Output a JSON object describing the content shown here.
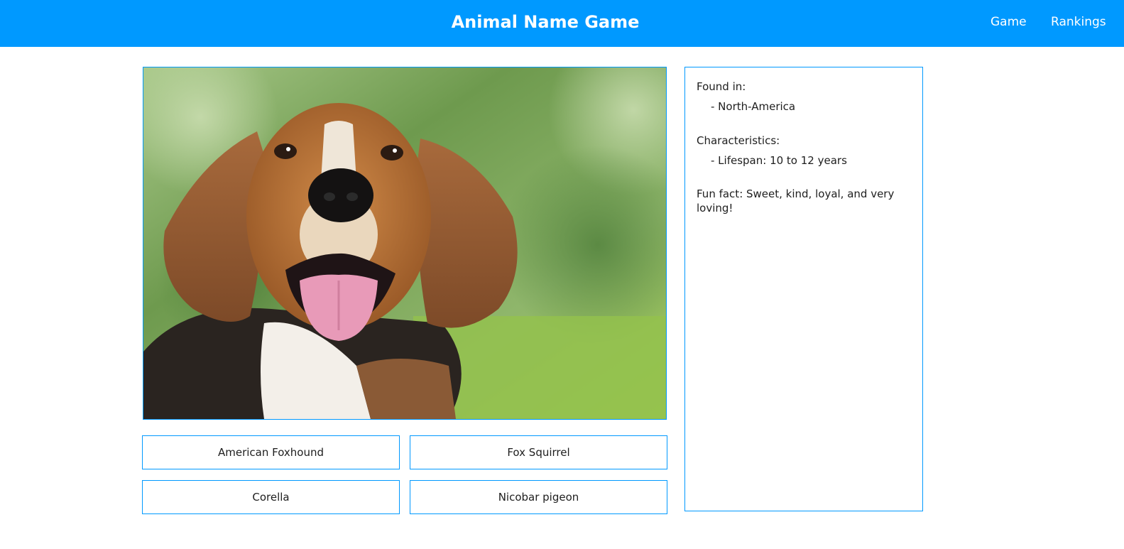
{
  "header": {
    "title": "Animal Name Game",
    "nav": [
      "Game",
      "Rankings"
    ],
    "background_color": "#0099ff"
  },
  "game": {
    "image_subject": "hound dog portrait",
    "options": [
      "American Foxhound",
      "Fox Squirrel",
      "Corella",
      "Nicobar pigeon"
    ]
  },
  "info": {
    "found_in_label": "Found in:",
    "found_in_items": [
      "- North-America"
    ],
    "characteristics_label": "Characteristics:",
    "characteristics_items": [
      "- Lifespan: 10 to 12 years"
    ],
    "fun_fact": "Fun fact: Sweet, kind, loyal, and very loving!"
  },
  "colors": {
    "accent": "#0099ff",
    "text": "#1e1e1e"
  }
}
